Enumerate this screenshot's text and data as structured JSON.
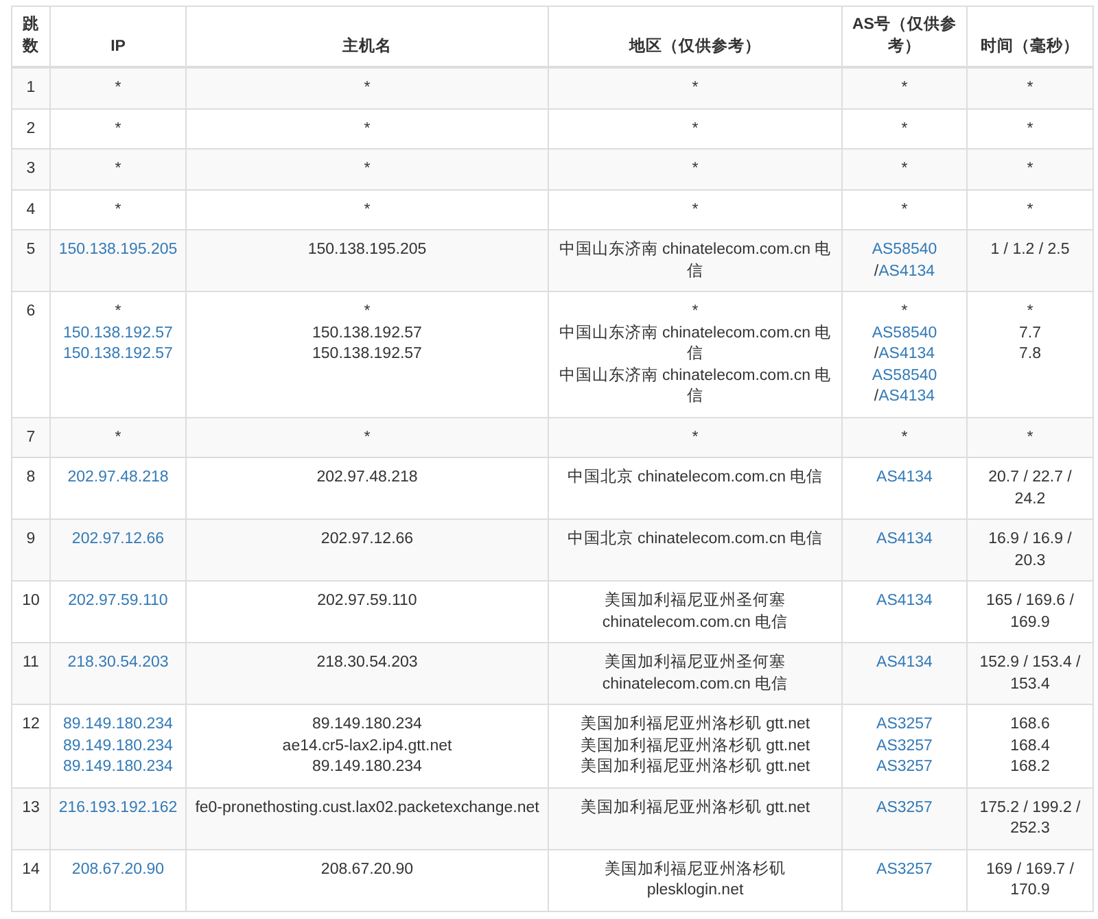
{
  "table": {
    "columns": [
      "跳数",
      "IP",
      "主机名",
      "地区（仅供参考）",
      "AS号（仅供参考）",
      "时间（毫秒）"
    ],
    "rows": [
      {
        "hop": "1",
        "ip": [
          {
            "text": "*",
            "link": false
          }
        ],
        "host": [
          "*"
        ],
        "region": [
          "*"
        ],
        "asn": [
          {
            "text": "*"
          }
        ],
        "time": [
          "*"
        ]
      },
      {
        "hop": "2",
        "ip": [
          {
            "text": "*",
            "link": false
          }
        ],
        "host": [
          "*"
        ],
        "region": [
          "*"
        ],
        "asn": [
          {
            "text": "*"
          }
        ],
        "time": [
          "*"
        ]
      },
      {
        "hop": "3",
        "ip": [
          {
            "text": "*",
            "link": false
          }
        ],
        "host": [
          "*"
        ],
        "region": [
          "*"
        ],
        "asn": [
          {
            "text": "*"
          }
        ],
        "time": [
          "*"
        ]
      },
      {
        "hop": "4",
        "ip": [
          {
            "text": "*",
            "link": false
          }
        ],
        "host": [
          "*"
        ],
        "region": [
          "*"
        ],
        "asn": [
          {
            "text": "*"
          }
        ],
        "time": [
          "*"
        ]
      },
      {
        "hop": "5",
        "ip": [
          {
            "text": "150.138.195.205",
            "link": true
          }
        ],
        "host": [
          "150.138.195.205"
        ],
        "region": [
          "中国山东济南 chinatelecom.com.cn 电信"
        ],
        "asn": [
          {
            "as": [
              "AS58540",
              "AS4134"
            ],
            "sep": "/"
          }
        ],
        "time": [
          "1 / 1.2 / 2.5"
        ]
      },
      {
        "hop": "6",
        "ip": [
          {
            "text": "*",
            "link": false
          },
          {
            "text": "150.138.192.57",
            "link": true
          },
          {
            "text": "150.138.192.57",
            "link": true
          }
        ],
        "host": [
          "*",
          "150.138.192.57",
          "150.138.192.57"
        ],
        "region": [
          "*",
          "中国山东济南 chinatelecom.com.cn 电信",
          "中国山东济南 chinatelecom.com.cn 电信"
        ],
        "asn": [
          {
            "text": "*"
          },
          {
            "as": [
              "AS58540",
              "AS4134"
            ],
            "sep": "/"
          },
          {
            "as": [
              "AS58540",
              "AS4134"
            ],
            "sep": "/"
          }
        ],
        "time": [
          "*",
          "7.7",
          "7.8"
        ]
      },
      {
        "hop": "7",
        "ip": [
          {
            "text": "*",
            "link": false
          }
        ],
        "host": [
          "*"
        ],
        "region": [
          "*"
        ],
        "asn": [
          {
            "text": "*"
          }
        ],
        "time": [
          "*"
        ]
      },
      {
        "hop": "8",
        "ip": [
          {
            "text": "202.97.48.218",
            "link": true
          }
        ],
        "host": [
          "202.97.48.218"
        ],
        "region": [
          "中国北京 chinatelecom.com.cn 电信"
        ],
        "asn": [
          {
            "as": [
              "AS4134"
            ]
          }
        ],
        "time": [
          "20.7 / 22.7 / 24.2"
        ]
      },
      {
        "hop": "9",
        "ip": [
          {
            "text": "202.97.12.66",
            "link": true
          }
        ],
        "host": [
          "202.97.12.66"
        ],
        "region": [
          "中国北京 chinatelecom.com.cn 电信"
        ],
        "asn": [
          {
            "as": [
              "AS4134"
            ]
          }
        ],
        "time": [
          "16.9 / 16.9 / 20.3"
        ]
      },
      {
        "hop": "10",
        "ip": [
          {
            "text": "202.97.59.110",
            "link": true
          }
        ],
        "host": [
          "202.97.59.110"
        ],
        "region": [
          "美国加利福尼亚州圣何塞 chinatelecom.com.cn 电信"
        ],
        "asn": [
          {
            "as": [
              "AS4134"
            ]
          }
        ],
        "time": [
          "165 / 169.6 / 169.9"
        ]
      },
      {
        "hop": "11",
        "ip": [
          {
            "text": "218.30.54.203",
            "link": true
          }
        ],
        "host": [
          "218.30.54.203"
        ],
        "region": [
          "美国加利福尼亚州圣何塞 chinatelecom.com.cn 电信"
        ],
        "asn": [
          {
            "as": [
              "AS4134"
            ]
          }
        ],
        "time": [
          "152.9 / 153.4 / 153.4"
        ]
      },
      {
        "hop": "12",
        "ip": [
          {
            "text": "89.149.180.234",
            "link": true
          },
          {
            "text": "89.149.180.234",
            "link": true
          },
          {
            "text": "89.149.180.234",
            "link": true
          }
        ],
        "host": [
          "89.149.180.234",
          "ae14.cr5-lax2.ip4.gtt.net",
          "89.149.180.234"
        ],
        "region": [
          "美国加利福尼亚州洛杉矶 gtt.net",
          "美国加利福尼亚州洛杉矶 gtt.net",
          "美国加利福尼亚州洛杉矶 gtt.net"
        ],
        "asn": [
          {
            "as": [
              "AS3257"
            ]
          },
          {
            "as": [
              "AS3257"
            ]
          },
          {
            "as": [
              "AS3257"
            ]
          }
        ],
        "time": [
          "168.6",
          "168.4",
          "168.2"
        ]
      },
      {
        "hop": "13",
        "ip": [
          {
            "text": "216.193.192.162",
            "link": true
          }
        ],
        "host": [
          "fe0-pronethosting.cust.lax02.packetexchange.net"
        ],
        "region": [
          "美国加利福尼亚州洛杉矶 gtt.net"
        ],
        "asn": [
          {
            "as": [
              "AS3257"
            ]
          }
        ],
        "time": [
          "175.2 / 199.2 / 252.3"
        ]
      },
      {
        "hop": "14",
        "ip": [
          {
            "text": "208.67.20.90",
            "link": true
          }
        ],
        "host": [
          "208.67.20.90"
        ],
        "region": [
          "美国加利福尼亚州洛杉矶 plesklogin.net"
        ],
        "asn": [
          {
            "as": [
              "AS3257"
            ]
          }
        ],
        "time": [
          "169 / 169.7 / 170.9"
        ]
      }
    ]
  }
}
